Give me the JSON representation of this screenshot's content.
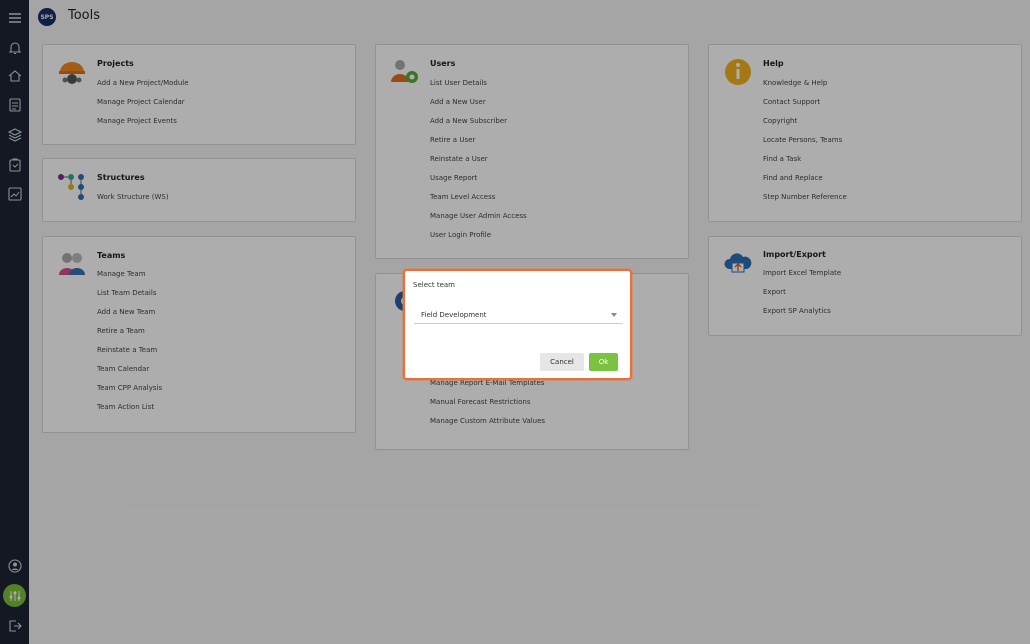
{
  "app": {
    "logo_text": "SPS",
    "title": "Tools"
  },
  "colors": {
    "sidebar_bg": "#1c2433",
    "accent_green": "#7bc142",
    "modal_border": "#e8703a",
    "logo_bg": "#1a2d6b"
  },
  "sidebar": {
    "icons": [
      "menu-icon",
      "bell-icon",
      "home-icon",
      "document-icon",
      "layers-icon",
      "clipboard-icon",
      "chart-icon",
      "user-icon",
      "settings-sliders-icon",
      "logout-icon"
    ]
  },
  "cards": {
    "projects": {
      "title": "Projects",
      "icon": "construction-helmet-icon",
      "links": [
        "Add a New Project/Module",
        "Manage Project Calendar",
        "Manage Project Events"
      ]
    },
    "structures": {
      "title": "Structures",
      "icon": "tree-structure-icon",
      "links": [
        "Work Structure (WS)"
      ]
    },
    "teams": {
      "title": "Teams",
      "icon": "team-icon",
      "links": [
        "Manage Team",
        "List Team Details",
        "Add a New Team",
        "Retire a Team",
        "Reinstate a Team",
        "Team Calendar",
        "Team CPP Analysis",
        "Team Action List"
      ]
    },
    "users": {
      "title": "Users",
      "icon": "user-gear-icon",
      "links": [
        "List User Details",
        "Add a New User",
        "Add a New Subscriber",
        "Retire a User",
        "Reinstate a User",
        "Usage Report",
        "Team Level Access",
        "Manage User Admin Access",
        "User Login Profile"
      ]
    },
    "admin": {
      "icon": "gear-icon",
      "links": [
        "Manage Report E-Mail Templates",
        "Manual Forecast Restrictions",
        "Manage Custom Attribute Values"
      ]
    },
    "help": {
      "title": "Help",
      "icon": "info-icon",
      "links": [
        "Knowledge & Help",
        "Contact Support",
        "Copyright",
        "Locate Persons, Teams",
        "Find a Task",
        "Find and Replace",
        "Step Number Reference"
      ]
    },
    "import_export": {
      "title": "Import/Export",
      "icon": "cloud-upload-icon",
      "links": [
        "Import Excel Template",
        "Export",
        "Export SP Analytics"
      ]
    }
  },
  "modal": {
    "title": "Select team",
    "selected_value": "Field Development",
    "cancel_label": "Cancel",
    "ok_label": "Ok"
  }
}
